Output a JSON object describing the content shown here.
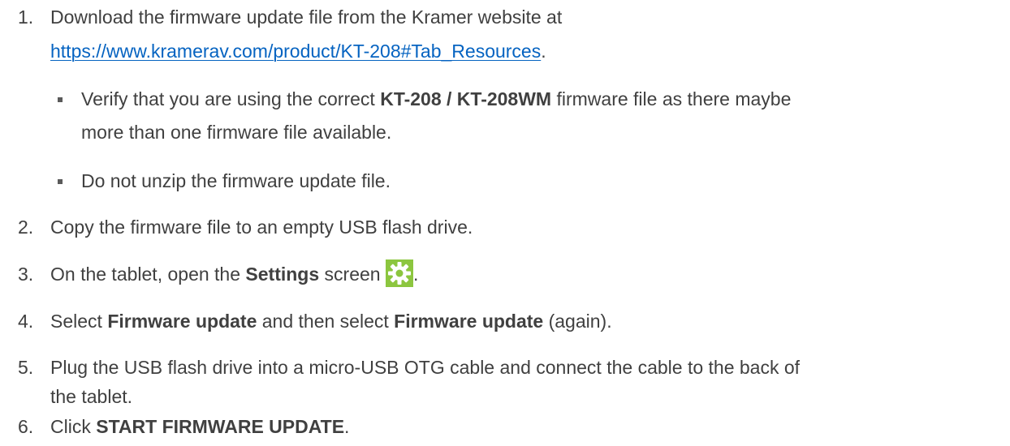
{
  "steps": [
    {
      "number": "1.",
      "line1": "Download the firmware update file from the Kramer website at",
      "link": "https://www.kramerav.com/product/KT-208#Tab_Resources",
      "link_suffix": ".",
      "bullets": [
        {
          "pre": "Verify that you are using the correct ",
          "bold": "KT-208 / KT-208WM",
          "post": " firmware file as there maybe",
          "line2": "more than one firmware file available."
        },
        {
          "text": "Do not unzip the firmware update file."
        }
      ]
    },
    {
      "number": "2.",
      "text": "Copy the firmware file to an empty USB flash drive."
    },
    {
      "number": "3.",
      "pre": "On the tablet, open the ",
      "bold": "Settings",
      "post": " screen",
      "suffix": ".",
      "icon": "settings-gear-icon",
      "icon_color": "#8cc63f"
    },
    {
      "number": "4.",
      "pre": "Select ",
      "bold1": "Firmware update",
      "mid": " and then select ",
      "bold2": "Firmware update",
      "post": " (again)."
    },
    {
      "number": "5.",
      "line1": "Plug the USB flash drive into a micro-USB OTG cable and connect the cable to the back of",
      "line2": "the tablet."
    },
    {
      "number": "6.",
      "pre": "Click ",
      "bold": "START FIRMWARE UPDATE",
      "post": "."
    }
  ],
  "colors": {
    "text": "#404040",
    "link": "#0563c1",
    "icon_bg": "#8cc63f"
  }
}
